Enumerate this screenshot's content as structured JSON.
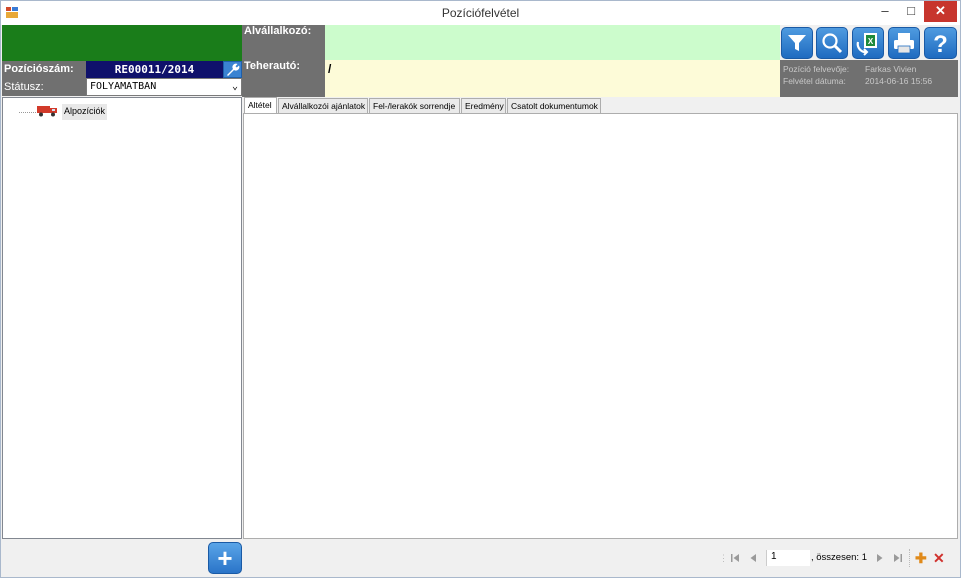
{
  "window": {
    "title": "Pozíciófelvétel",
    "minimize_glyph": "–",
    "maximize_glyph": "□",
    "close_glyph": "✕"
  },
  "header": {
    "alvallalkozo_label": "Alvállalkozó:",
    "alvallalkozo_value": "",
    "teherauto_label": "Teherautó:",
    "teherauto_value": "/",
    "poziciosszam_label": "Pozíciószám:",
    "poziciosszam_value": "RE00011/2014",
    "statusz_label": "Státusz:",
    "statusz_value": "FOLYAMATBAN"
  },
  "toolbar": {
    "icons": [
      "filter-icon",
      "search-icon",
      "excel-export-icon",
      "print-icon",
      "help-icon"
    ]
  },
  "info": {
    "felvevo_label": "Pozíció felvevője:",
    "felvevo_value": "Farkas Vivien",
    "datum_label": "Felvétel dátuma:",
    "datum_value": "2014-06-16 15:56"
  },
  "tree": {
    "root_label": "Alpozíciók"
  },
  "tabs": [
    {
      "label": "Altétel",
      "active": true
    },
    {
      "label": "Alvállalkozói ajánlatok",
      "active": false
    },
    {
      "label": "Fel-/lerakók sorrendje",
      "active": false
    },
    {
      "label": "Eredmény",
      "active": false
    },
    {
      "label": "Csatolt dokumentumok",
      "active": false
    }
  ],
  "navigator": {
    "page_value": "1",
    "total_text": ", összesen: 1"
  },
  "colors": {
    "header_green": "#1a7d1a",
    "subcontractor_bg": "#ccfccc",
    "truck_bg": "#fdfbd8",
    "position_bg": "#0f116b",
    "label_gray": "#707070",
    "accent_blue": "#2a74c8",
    "close_red": "#c7352d"
  }
}
